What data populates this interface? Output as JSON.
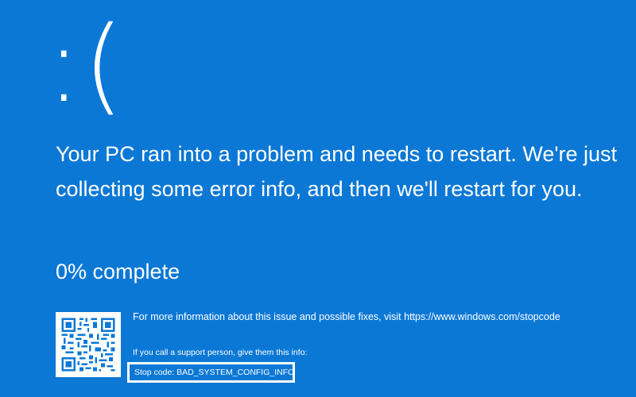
{
  "screen": {
    "background_color": "#0b78d6",
    "text_color": "#ffffff",
    "sad_face": ":(",
    "message": "Your PC ran into a problem and needs to restart. We're just collecting some error info, and then we'll restart for you.",
    "progress_text": "0% complete",
    "progress_percent": 0,
    "more_info": "For more information about this issue and possible fixes, visit https://www.windows.com/stopcode",
    "support_info": "If you call a support person, give them this info:",
    "stop_code": "Stop code: BAD_SYSTEM_CONFIG_INFO"
  },
  "icons": {
    "qr_code": "qr-code-icon"
  }
}
